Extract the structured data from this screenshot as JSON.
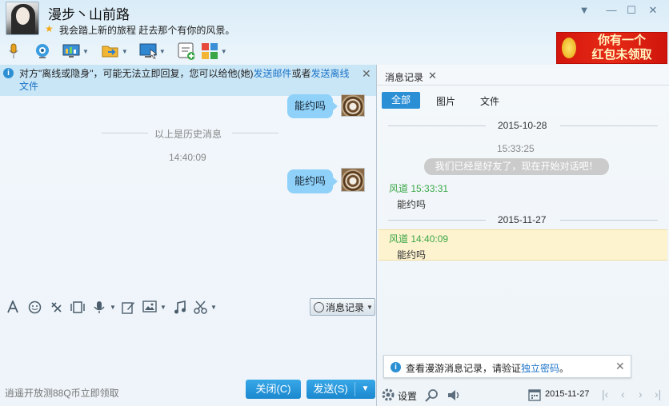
{
  "header": {
    "contact_name": "漫步丶山前路",
    "signature": "我会踏上新的旅程 赶去那个有你的风景。"
  },
  "window_controls": {
    "dropdown": "▼",
    "minimize": "—",
    "maximize": "☐",
    "close": "✕"
  },
  "ad_banner": {
    "line1": "你有一个",
    "line2": "红包未领取"
  },
  "offline_bar": {
    "text_before": "对方\"离线或隐身\"，可能无法立即回复，您可以给他(她)",
    "link1": "发送邮件",
    "middle": "或者",
    "link2": "发送离线文件"
  },
  "chat": {
    "messages": [
      {
        "text": "能约吗"
      },
      {
        "text": "能约吗"
      }
    ],
    "history_label": "以上是历史消息",
    "timestamp": "14:40:09"
  },
  "input_toolbar": {
    "history_button": "消息记录"
  },
  "bottom": {
    "promo": "逍遥开放测88Q币立即领取",
    "close_label": "关闭(C)",
    "send_label": "发送(S)"
  },
  "history_panel": {
    "tab_title": "消息记录",
    "filters": [
      "全部",
      "图片",
      "文件"
    ],
    "date1": "2015-10-28",
    "sys_time": "15:33:25",
    "sys_notice": "我们已经是好友了，现在开始对话吧！",
    "records": [
      {
        "name": "风道",
        "time": "15:33:31",
        "text": "能约吗"
      },
      {
        "name": "风道",
        "time": "14:40:09",
        "text": "能约吗"
      }
    ],
    "date2": "2015-11-27",
    "roam_tip": {
      "text": "查看漫游消息记录，请验证",
      "link": "独立密码",
      "end": "。"
    },
    "settings_label": "设置",
    "current_date": "2015-11-27"
  },
  "colors": {
    "accent": "#2b8fd6",
    "bubble": "#8fd1f8",
    "name_green": "#3aa647",
    "highlight": "#fdf3cf"
  }
}
